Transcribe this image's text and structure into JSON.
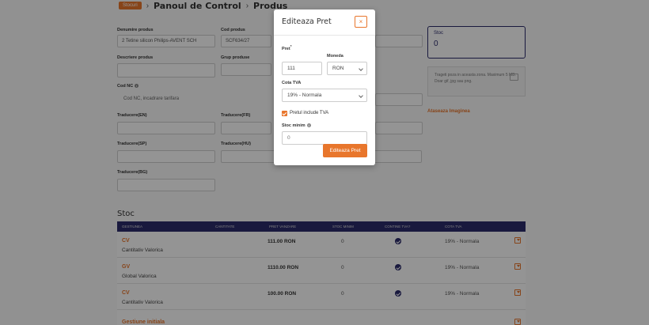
{
  "header": {
    "tag": "Stocuri",
    "breadcrumb": [
      "Panoul de Control",
      "Produs"
    ],
    "sep": "›"
  },
  "form": {
    "denumire_label": "Denumire produs",
    "denumire_value": "2 Tetine silicon Philips-AVENT SCH",
    "cod_label": "Cod produs",
    "cod_value": "SCF634/27",
    "descriere_label": "Descriere produs",
    "grup_label": "Grup produse",
    "codnc_label": "Cod NC",
    "codnc_value": "Cod NC, incadrare tarifara",
    "traducere_en": "Traducere(EN)",
    "traducere_fr": "Traducere(FR)",
    "traducere_sp": "Traducere(SP)",
    "traducere_hu": "Traducere(HU)",
    "traducere_bg": "Traducere(BG)"
  },
  "stoc_card": {
    "label": "Stoc",
    "value": "0"
  },
  "upload": {
    "text": "Trageti poza in aceasta zona. Maximum 5 MB. Doar gif, jpg sau png.",
    "link": "Ataseaza Imaginea"
  },
  "stoc_section": {
    "title": "Stoc",
    "columns": [
      "Gestiunea",
      "Cantitate",
      "Pret Vanzare",
      "Stoc Minim",
      "Contine TVA?",
      "Cota TVA"
    ],
    "rows": [
      {
        "code": "CV",
        "name": "Cantitativ Valorica",
        "pret": "111.00 RON",
        "stoc_minim": "0",
        "tva": "19% - Normala"
      },
      {
        "code": "GV",
        "name": "Global Valorica",
        "pret": "1110.00 RON",
        "stoc_minim": "0",
        "tva": "19% - Normala"
      },
      {
        "code": "CV",
        "name": "Cantitativ Valorica",
        "pret": "100.00 RON",
        "stoc_minim": "0",
        "tva": "19% - Normala"
      },
      {
        "code": "Gestiune initiala",
        "name": "",
        "pret": "",
        "stoc_minim": "",
        "tva": ""
      }
    ]
  },
  "modal": {
    "title": "Editeaza Pret",
    "close": "×",
    "pret_label": "Pret",
    "pret_required": "*",
    "pret_value": "111",
    "moneda_label": "Moneda",
    "moneda_value": "RON",
    "cota_label": "Cota TVA",
    "cota_value": "19% - Normala",
    "include_tva_label": "Pretul include TVA",
    "include_tva_checked": true,
    "stoc_minim_label": "Stoc minim",
    "stoc_minim_placeholder": "0",
    "submit_label": "Editeaza Pret"
  },
  "colors": {
    "accent": "#e8762c",
    "navy": "#2c2c6b"
  }
}
